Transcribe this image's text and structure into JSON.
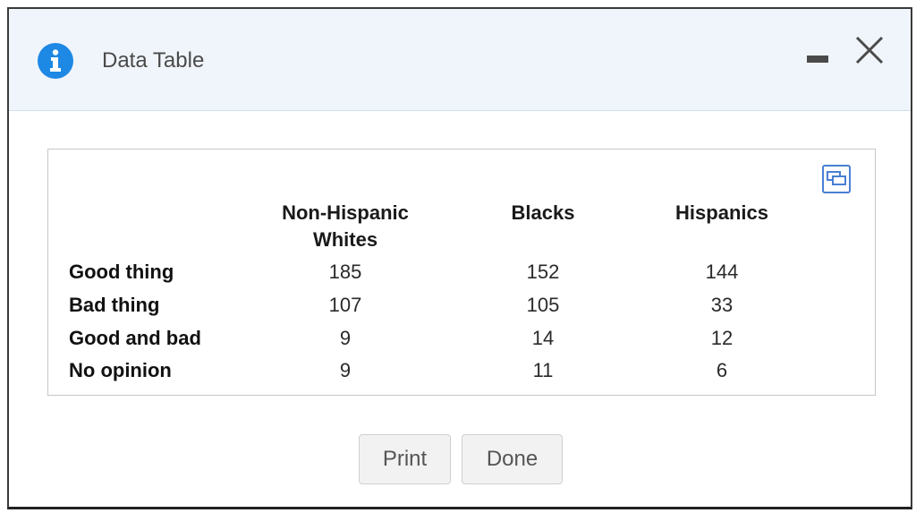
{
  "window": {
    "title": "Data Table"
  },
  "table": {
    "columns": [
      "Non-Hispanic Whites",
      "Blacks",
      "Hispanics"
    ],
    "column_lines": [
      [
        "Non-Hispanic",
        "Whites"
      ],
      [
        "Blacks"
      ],
      [
        "Hispanics"
      ]
    ],
    "rows": [
      {
        "label": "Good thing",
        "values": [
          "185",
          "152",
          "144"
        ]
      },
      {
        "label": "Bad thing",
        "values": [
          "107",
          "105",
          "33"
        ]
      },
      {
        "label": "Good and bad",
        "values": [
          "9",
          "14",
          "12"
        ]
      },
      {
        "label": "No opinion",
        "values": [
          "9",
          "11",
          "6"
        ]
      }
    ]
  },
  "buttons": {
    "print": "Print",
    "done": "Done"
  },
  "colors": {
    "accent": "#1e88e5",
    "titlebar_bg": "#f0f5fb"
  },
  "icons": {
    "info": "info-icon",
    "minimize": "minimize-icon",
    "close": "close-icon",
    "popout": "popout-icon"
  }
}
